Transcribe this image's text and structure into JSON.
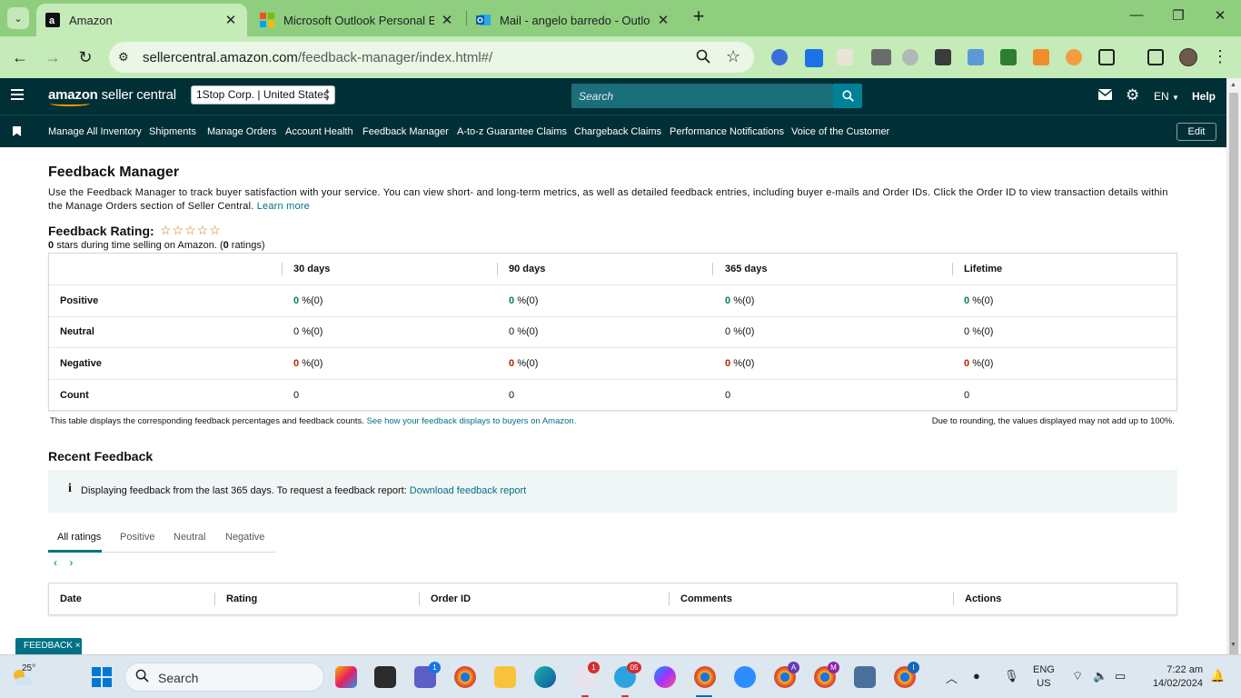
{
  "browser": {
    "tabs": [
      {
        "title": "Amazon",
        "favicon": "amazon-icon",
        "active": true
      },
      {
        "title": "Microsoft Outlook Personal Em",
        "favicon": "microsoft-icon",
        "active": false
      },
      {
        "title": "Mail - angelo barredo - Outlook",
        "favicon": "outlook-icon",
        "active": false
      }
    ],
    "url_host": "sellercentral.amazon.com",
    "url_path": "/feedback-manager/index.html#/"
  },
  "header": {
    "logo_amazon": "amazon",
    "logo_product": "seller central",
    "account": "1Stop Corp. | United States",
    "search_placeholder": "Search",
    "language": "EN",
    "help": "Help"
  },
  "nav": {
    "items": [
      "Manage All Inventory",
      "Shipments",
      "Manage Orders",
      "Account Health",
      "Feedback Manager",
      "A-to-z Guarantee Claims",
      "Chargeback Claims",
      "Performance Notifications",
      "Voice of the Customer"
    ],
    "edit": "Edit"
  },
  "page": {
    "title": "Feedback Manager",
    "description": "Use the Feedback Manager to track buyer satisfaction with your service. You can view short- and long-term metrics, as well as detailed feedback entries, including buyer e-mails and Order IDs. Click the Order ID to view transaction details within the Manage Orders section of Seller Central.",
    "learn_more": "Learn more",
    "rating_label": "Feedback Rating:",
    "stars": "☆☆☆☆☆",
    "rating_count": "0",
    "rating_sub_text": "stars during time selling on Amazon. (",
    "rating_ratings_count": "0",
    "rating_sub_end": "ratings)"
  },
  "feedback_table": {
    "columns": [
      "",
      "30 days",
      "90 days",
      "365 days",
      "Lifetime"
    ],
    "rows": [
      {
        "label": "Positive",
        "values": [
          "0",
          "0",
          "0",
          "0"
        ],
        "suffix": "%(0)",
        "color": "#067d62"
      },
      {
        "label": "Neutral",
        "values": [
          "0",
          "0",
          "0",
          "0"
        ],
        "suffix": "%(0)",
        "color": "#0f1111"
      },
      {
        "label": "Negative",
        "values": [
          "0",
          "0",
          "0",
          "0"
        ],
        "suffix": "%(0)",
        "color": "#b12704"
      },
      {
        "label": "Count",
        "values": [
          "0",
          "0",
          "0",
          "0"
        ],
        "suffix": "",
        "color": "#0f1111"
      }
    ],
    "note_left": "This table displays the corresponding feedback percentages and feedback counts.",
    "note_left_link": "See how your feedback displays to buyers on Amazon.",
    "note_right": "Due to rounding, the values displayed may not add up to 100%."
  },
  "recent": {
    "title": "Recent Feedback",
    "info_text": "Displaying feedback from the last 365 days. To request a feedback report:",
    "info_link": "Download feedback report",
    "tabs": [
      "All ratings",
      "Positive",
      "Neutral",
      "Negative"
    ],
    "pager_prev": "‹",
    "pager_next": "›",
    "columns": [
      "Date",
      "Rating",
      "Order ID",
      "Comments",
      "Actions"
    ]
  },
  "feedback_tab": "FEEDBACK ×",
  "taskbar": {
    "temperature": "25°",
    "search": "Search",
    "lang_top": "ENG",
    "lang_bottom": "US",
    "time": "7:22 am",
    "date": "14/02/2024",
    "badges": [
      "1",
      "1",
      "05",
      "A",
      "M",
      "I"
    ]
  },
  "colors": {
    "amazon_header": "#002f36",
    "accent_link": "#007185",
    "positive": "#067d62",
    "negative": "#b12704",
    "tab_strip": "#8fce7f"
  }
}
